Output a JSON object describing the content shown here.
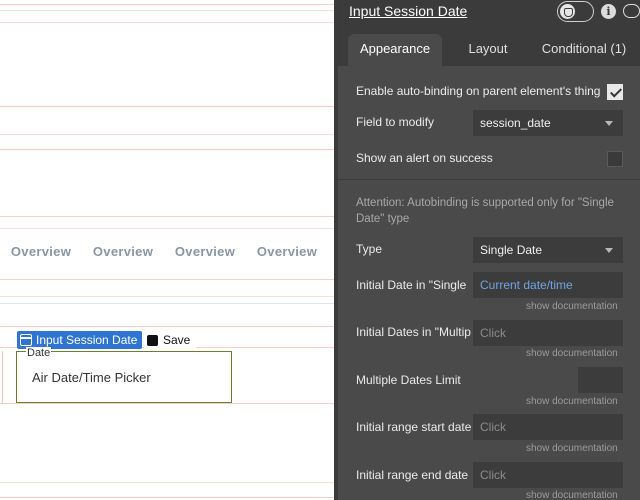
{
  "canvas": {
    "overview_tabs": [
      "Overview",
      "Overview",
      "Overview",
      "Overview"
    ],
    "element_label": "Input Session Date",
    "save_label": "Save",
    "picker_caption": "Date",
    "picker_placeholder": "Air Date/Time Picker"
  },
  "panel": {
    "title": "Input Session Date",
    "tabs": [
      {
        "label": "Appearance",
        "active": true
      },
      {
        "label": "Layout",
        "active": false
      },
      {
        "label": "Conditional (1)",
        "active": false
      }
    ],
    "autobinding": {
      "label": "Enable auto-binding on parent element's thing",
      "checked": true
    },
    "field_to_modify": {
      "label": "Field to modify",
      "value": "session_date"
    },
    "alert_on_success": {
      "label": "Show an alert on success",
      "checked": false
    },
    "attention_text": "Attention: Autobinding is supported only for \"Single Date\" type",
    "type": {
      "label": "Type",
      "value": "Single Date"
    },
    "initial_date": {
      "label": "Initial Date in \"Single",
      "value": "Current date/time",
      "doc": "show documentation"
    },
    "initial_dates": {
      "label": "Initial Dates in \"Multip",
      "placeholder": "Click",
      "doc": "show documentation"
    },
    "multiple_dates_limit": {
      "label": "Multiple Dates Limit",
      "value": "",
      "doc": "show documentation"
    },
    "initial_range_start": {
      "label": "Initial range start date",
      "placeholder": "Click",
      "doc": "show documentation"
    },
    "initial_range_end": {
      "label": "Initial range end date",
      "placeholder": "Click",
      "doc": "show documentation"
    }
  },
  "colors": {
    "panel_bg": "#4a4a4a",
    "header_bg": "#3b3b3b",
    "accent_blue": "#2f74d0",
    "link_blue": "#6fa5e4"
  },
  "icons": [
    "calendar-icon",
    "cube-icon",
    "toggle-switch",
    "info-icon",
    "comment-icon",
    "checkmark-icon",
    "caret-down-icon"
  ]
}
